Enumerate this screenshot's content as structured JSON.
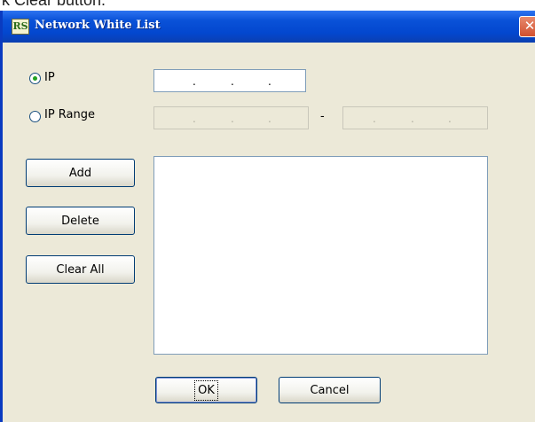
{
  "caption": {
    "text": "k Clear button."
  },
  "window": {
    "title": "Network White List",
    "icon_text": "RS",
    "icon": "app-icon",
    "close_glyph": "✕"
  },
  "ip_mode": {
    "selected": "IP",
    "options": [
      {
        "label": "IP",
        "checked": true
      },
      {
        "label": "IP Range",
        "checked": false
      }
    ],
    "ip_field": {
      "value": ". . ."
    },
    "range_separator": "-"
  },
  "buttons": {
    "add": "Add",
    "delete": "Delete",
    "clear_all": "Clear All",
    "ok": "OK",
    "cancel": "Cancel"
  },
  "white_list": {
    "items": []
  },
  "colors": {
    "title_bar": "#0a52d8",
    "dialog_bg": "#ece9d8",
    "close_button": "#d2502f",
    "radio_dot": "#21a121"
  }
}
